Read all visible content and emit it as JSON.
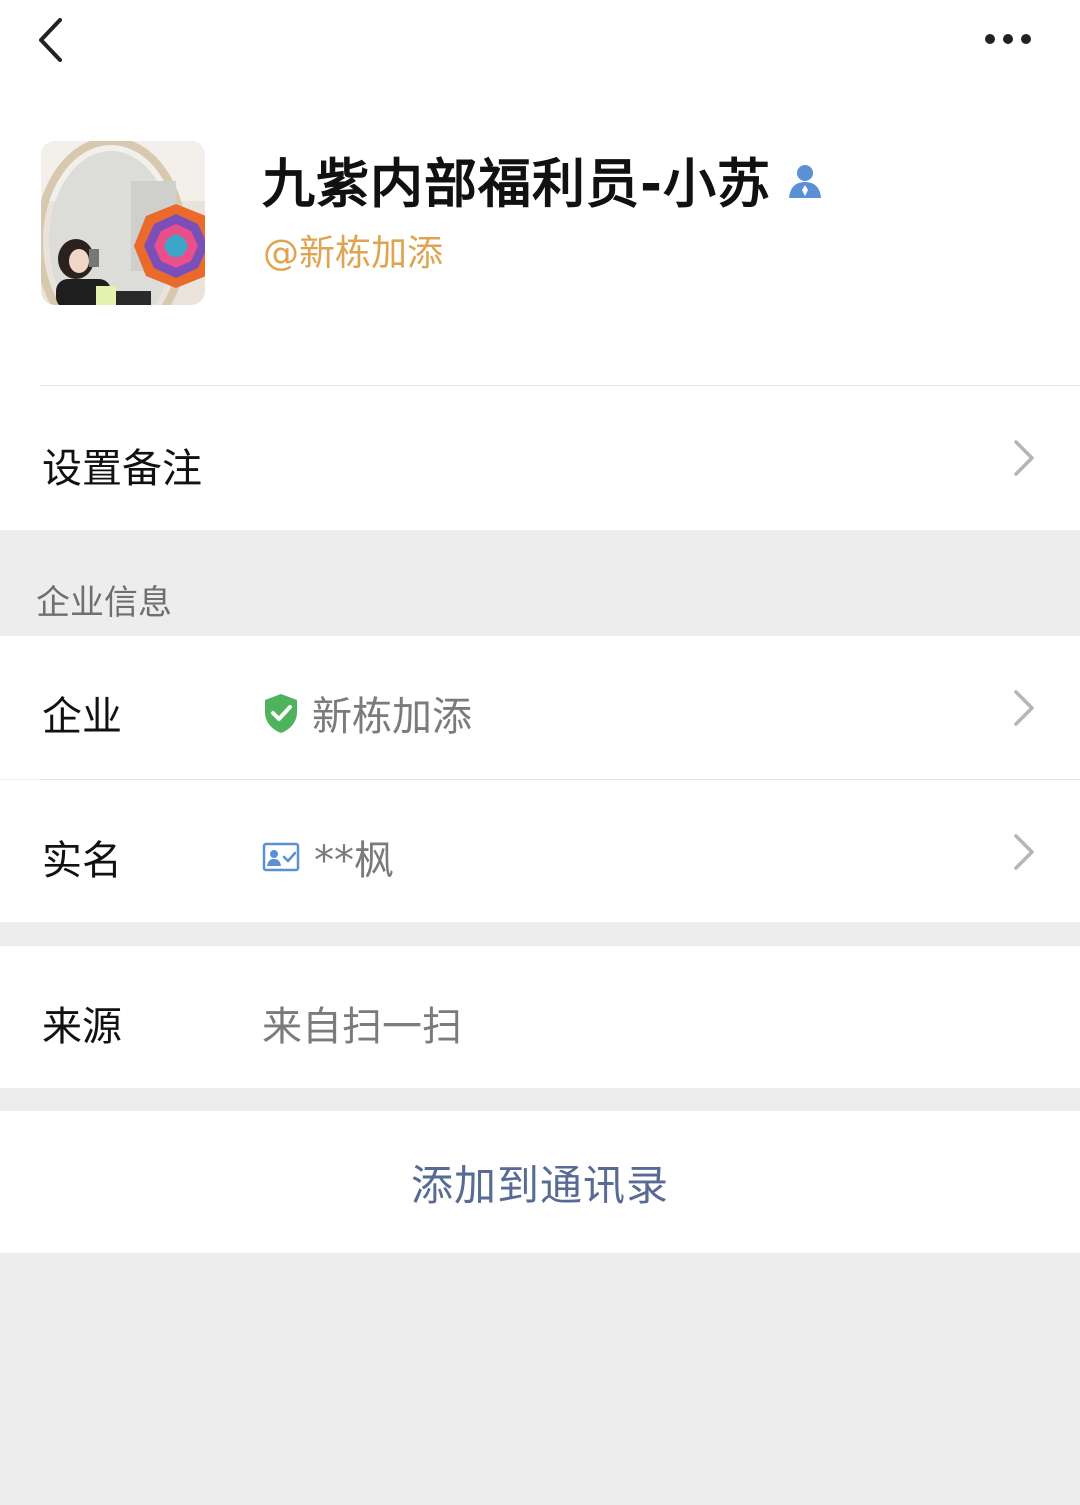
{
  "topbar": {
    "back_icon": "chevron-left-icon",
    "more_icon": "more-dots-icon"
  },
  "profile": {
    "name": "九紫内部福利员-小苏",
    "handle": "@新栋加添",
    "handle_color": "#e0a451",
    "badge_icon": "person-icon",
    "badge_color": "#5b8fd6"
  },
  "remark": {
    "label": "设置备注"
  },
  "enterprise_section": {
    "header": "企业信息"
  },
  "company": {
    "label": "企业",
    "value": "新栋加添",
    "icon": "verified-shield-icon",
    "icon_color": "#4fb35e"
  },
  "real_name": {
    "label": "实名",
    "value": "**枫",
    "icon": "id-card-icon"
  },
  "source": {
    "label": "来源",
    "value": "来自扫一扫"
  },
  "action": {
    "label": "添加到通讯录",
    "color": "#576b95"
  }
}
